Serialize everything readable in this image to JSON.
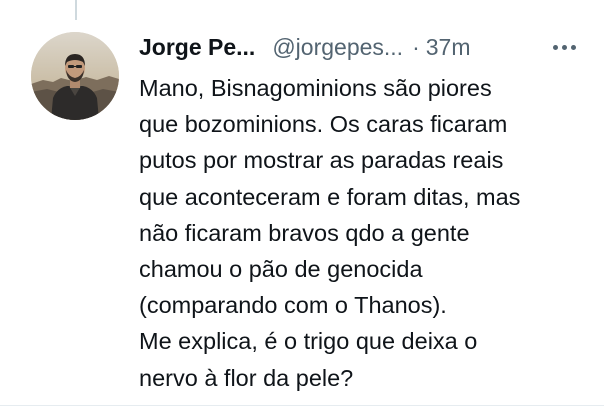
{
  "tweet": {
    "display_name": "Jorge Pe...",
    "handle": "@jorgepes...",
    "separator": "·",
    "time": "37m",
    "more_label": "···",
    "text_lines": [
      "Mano, Bisnagominions são piores",
      "que bozominions. Os caras ficaram",
      "putos por mostrar as paradas reais",
      "que aconteceram e foram ditas, mas",
      "não ficaram bravos qdo a gente",
      "chamou o pão de genocida",
      "(comparando com o Thanos).",
      "Me explica, é o trigo que deixa o",
      "nervo à flor da pele?"
    ]
  },
  "icons": {
    "more": "more-horizontal-icon",
    "avatar": "user-photo"
  },
  "colors": {
    "text_primary": "#0f1419",
    "text_secondary": "#536471",
    "thread_line": "#cfd9de"
  }
}
